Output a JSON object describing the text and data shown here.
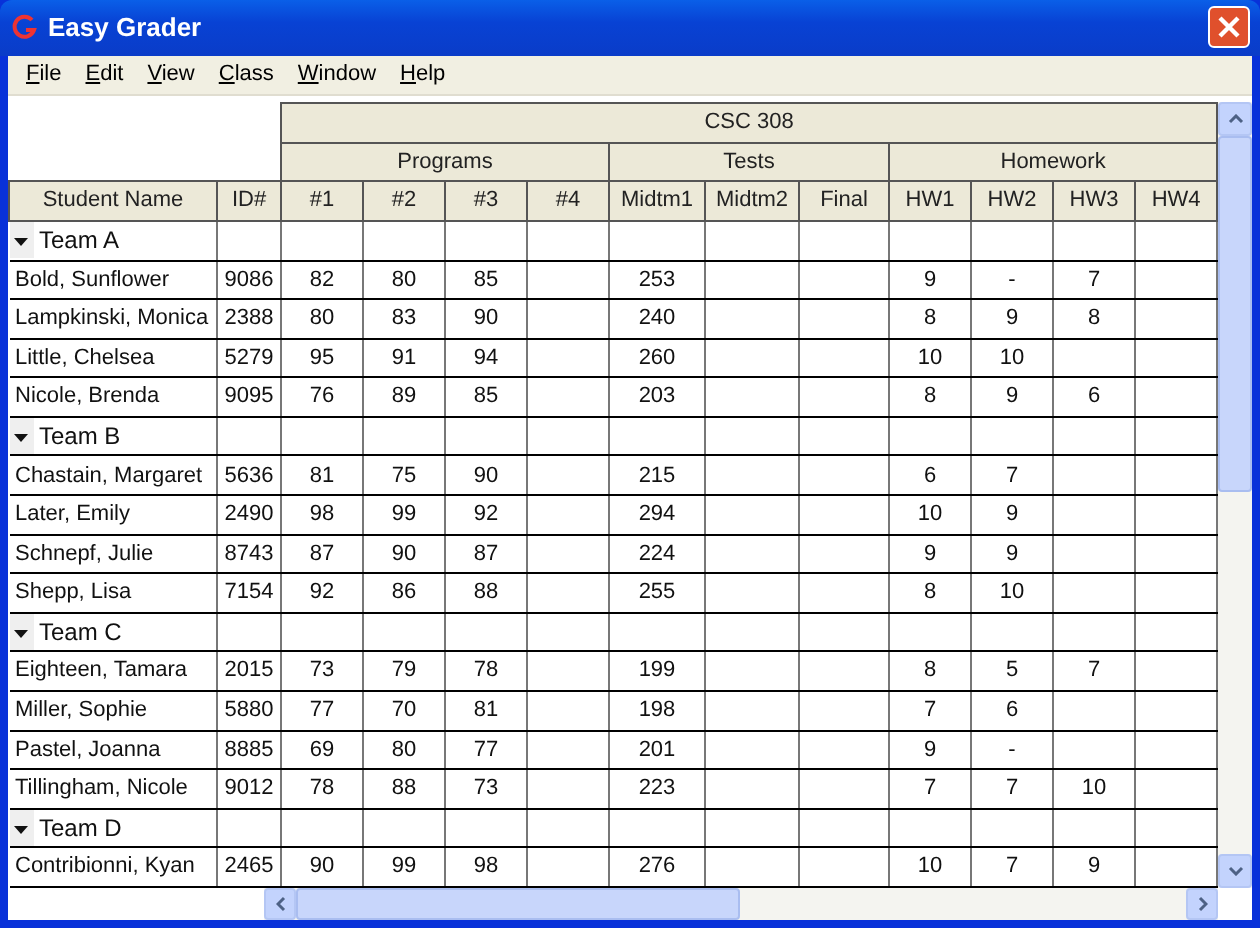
{
  "window": {
    "title": "Easy Grader"
  },
  "menu": [
    "File",
    "Edit",
    "View",
    "Class",
    "Window",
    "Help"
  ],
  "table": {
    "title": "CSC 308",
    "fixed_columns": [
      "Student Name",
      "ID#"
    ],
    "column_groups": [
      {
        "label": "Programs",
        "columns": [
          "#1",
          "#2",
          "#3",
          "#4"
        ]
      },
      {
        "label": "Tests",
        "columns": [
          "Midtm1",
          "Midtm2",
          "Final"
        ]
      },
      {
        "label": "Homework",
        "columns": [
          "HW1",
          "HW2",
          "HW3",
          "HW4"
        ]
      }
    ],
    "teams": [
      {
        "label": "Team A",
        "expanded": true,
        "students": [
          {
            "name": "Bold, Sunflower",
            "id": "9086",
            "scores": [
              [
                "82",
                "80",
                "85"
              ],
              [
                "253"
              ],
              [
                "9",
                "-",
                "7"
              ]
            ]
          },
          {
            "name": "Lampkinski, Monica",
            "id": "2388",
            "scores": [
              [
                "80",
                "83",
                "90"
              ],
              [
                "240"
              ],
              [
                "8",
                "9",
                "8"
              ]
            ]
          },
          {
            "name": "Little, Chelsea",
            "id": "5279",
            "scores": [
              [
                "95",
                "91",
                "94"
              ],
              [
                "260"
              ],
              [
                "10",
                "10"
              ]
            ]
          },
          {
            "name": "Nicole, Brenda",
            "id": "9095",
            "scores": [
              [
                "76",
                "89",
                "85"
              ],
              [
                "203"
              ],
              [
                "8",
                "9",
                "6"
              ]
            ]
          }
        ]
      },
      {
        "label": "Team B",
        "expanded": true,
        "students": [
          {
            "name": "Chastain, Margaret",
            "id": "5636",
            "scores": [
              [
                "81",
                "75",
                "90"
              ],
              [
                "215"
              ],
              [
                "6",
                "7"
              ]
            ]
          },
          {
            "name": "Later, Emily",
            "id": "2490",
            "scores": [
              [
                "98",
                "99",
                "92"
              ],
              [
                "294"
              ],
              [
                "10",
                "9"
              ]
            ]
          },
          {
            "name": "Schnepf, Julie",
            "id": "8743",
            "scores": [
              [
                "87",
                "90",
                "87"
              ],
              [
                "224"
              ],
              [
                "9",
                "9"
              ]
            ]
          },
          {
            "name": "Shepp, Lisa",
            "id": "7154",
            "scores": [
              [
                "92",
                "86",
                "88"
              ],
              [
                "255"
              ],
              [
                "8",
                "10"
              ]
            ]
          }
        ]
      },
      {
        "label": "Team C",
        "expanded": true,
        "students": [
          {
            "name": "Eighteen, Tamara",
            "id": "2015",
            "scores": [
              [
                "73",
                "79",
                "78"
              ],
              [
                "199"
              ],
              [
                "8",
                "5",
                "7"
              ]
            ]
          },
          {
            "name": "Miller, Sophie",
            "id": "5880",
            "scores": [
              [
                "77",
                "70",
                "81"
              ],
              [
                "198"
              ],
              [
                "7",
                "6"
              ]
            ]
          },
          {
            "name": "Pastel, Joanna",
            "id": "8885",
            "scores": [
              [
                "69",
                "80",
                "77"
              ],
              [
                "201"
              ],
              [
                "9",
                "-"
              ]
            ]
          },
          {
            "name": "Tillingham, Nicole",
            "id": "9012",
            "scores": [
              [
                "78",
                "88",
                "73"
              ],
              [
                "223"
              ],
              [
                "7",
                "7",
                "10"
              ]
            ]
          }
        ]
      },
      {
        "label": "Team D",
        "expanded": true,
        "students": [
          {
            "name": "Contribionni, Kyan",
            "id": "2465",
            "scores": [
              [
                "90",
                "99",
                "98"
              ],
              [
                "276"
              ],
              [
                "10",
                "7",
                "9"
              ]
            ]
          }
        ]
      }
    ]
  }
}
